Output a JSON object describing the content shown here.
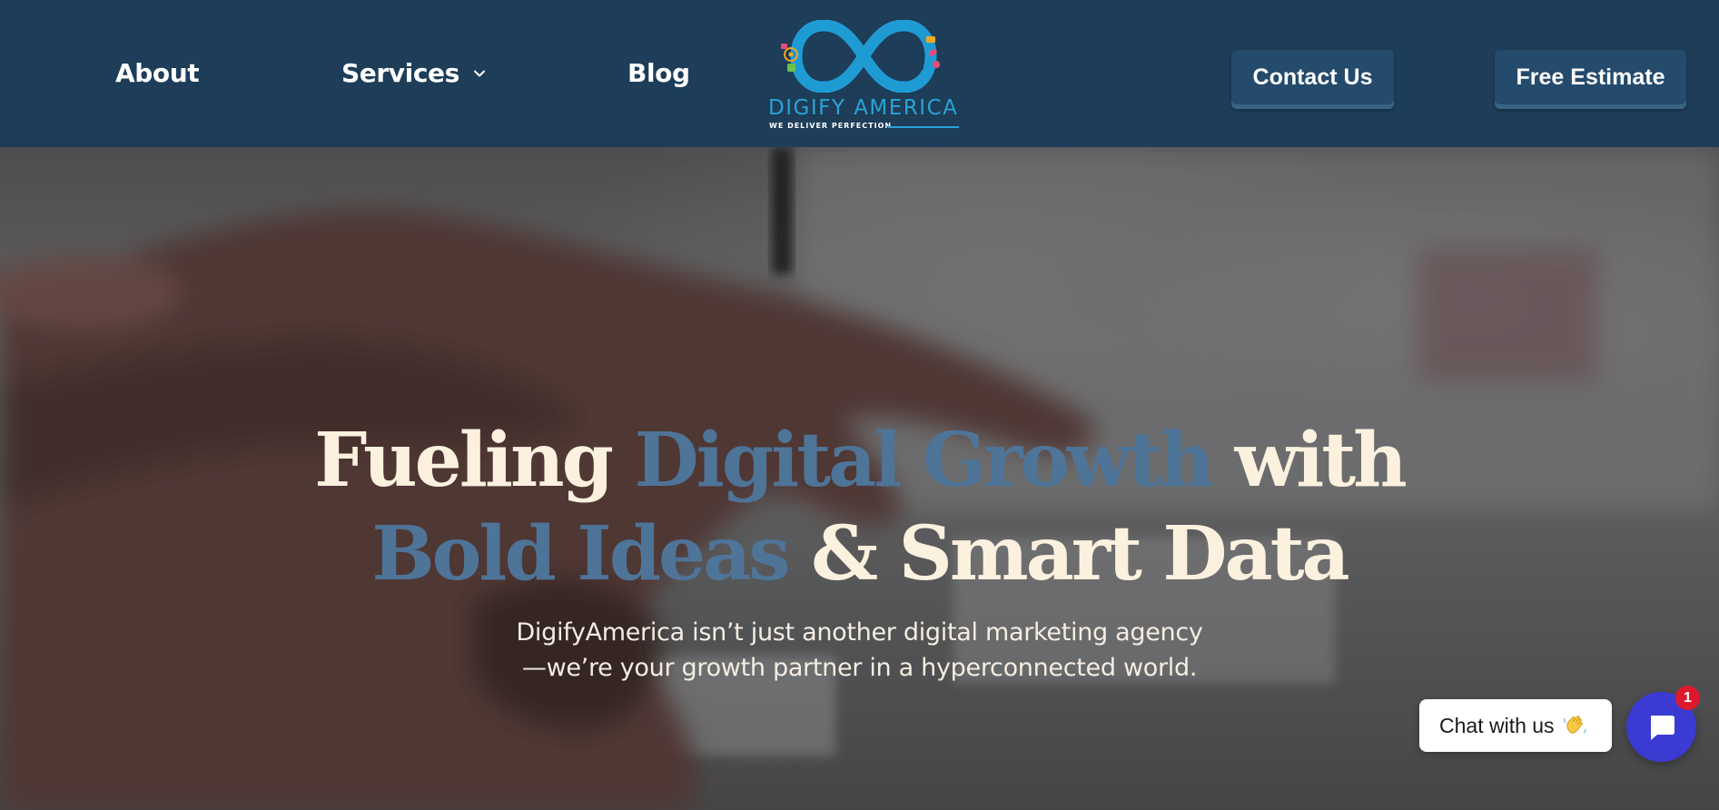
{
  "nav": {
    "about": "About",
    "services": "Services",
    "blog": "Blog"
  },
  "logo": {
    "wordmark": "DIGIFY AMERICA",
    "tagline": "WE DELIVER PERFECTION"
  },
  "header_buttons": {
    "contact": "Contact Us",
    "estimate": "Free Estimate"
  },
  "hero": {
    "line1_a": "Fueling ",
    "line1_accent": "Digital Growth",
    "line1_b": " with",
    "line2_accent": "Bold Ideas",
    "line2_b": " & Smart Data",
    "sub_line1": "DigifyAmerica isn’t just another digital marketing agency",
    "sub_line2": "—we’re your growth partner in a hyperconnected world."
  },
  "chat": {
    "prompt": "Chat with us",
    "badge_count": "1"
  },
  "colors": {
    "header_bg": "#1d3d58",
    "button_bg": "#244a6c",
    "logo_blue": "#29a3d6",
    "headline_cream": "#fbf1de",
    "headline_accent": "#4e7498",
    "chat_launcher": "#3b3ad2",
    "badge_red": "#e0182d"
  },
  "icons": {
    "services_caret": "chevron-down-icon",
    "chat_wave": "waving-hand-icon",
    "chat_launcher": "chat-bubble-icon"
  }
}
